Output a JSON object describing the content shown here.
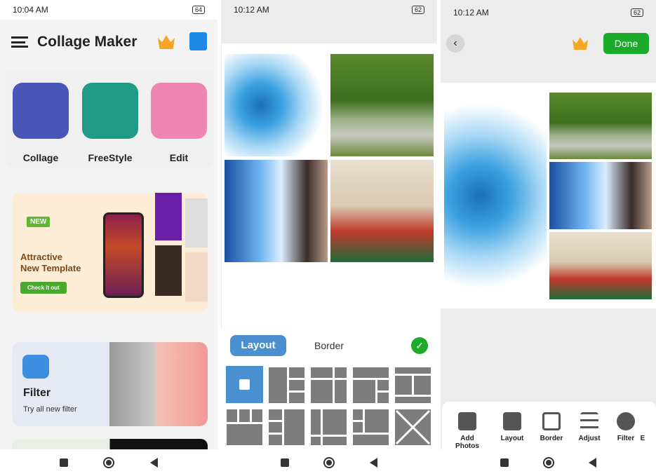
{
  "screen1": {
    "status": {
      "time": "10:04 AM",
      "battery": "64"
    },
    "header": {
      "title": "Collage Maker",
      "menu_icon": "hamburger-icon",
      "premium_icon": "crown-icon",
      "store_icon": "shop-bag-icon"
    },
    "tools": [
      {
        "label": "Collage",
        "color": "#4a55b8"
      },
      {
        "label": "FreeStyle",
        "color": "#1f9b86"
      },
      {
        "label": "Edit",
        "color": "#ee86b0"
      }
    ],
    "banner": {
      "badge": "NEW",
      "title_line1": "Attractive",
      "title_line2": "New Template",
      "cta": "Check it out"
    },
    "filter_card": {
      "title": "Filter",
      "subtitle": "Try all new filter"
    }
  },
  "screen2": {
    "status": {
      "time": "10:12 AM",
      "battery": "62"
    },
    "tabs": {
      "layout": "Layout",
      "border": "Border",
      "active": "Layout"
    },
    "confirm_icon": "check-circle-icon",
    "accent": "#4a8fd0"
  },
  "screen3": {
    "status": {
      "time": "10:12 AM",
      "battery": "62"
    },
    "done_label": "Done",
    "done_color": "#1aab2a",
    "toolbar": [
      {
        "label": "Add Photos",
        "icon": "add-photo-icon"
      },
      {
        "label": "Layout",
        "icon": "layout-icon"
      },
      {
        "label": "Border",
        "icon": "border-icon"
      },
      {
        "label": "Adjust",
        "icon": "sliders-icon"
      },
      {
        "label": "Filter",
        "icon": "filter-icon"
      },
      {
        "label": "E",
        "icon": ""
      }
    ]
  }
}
